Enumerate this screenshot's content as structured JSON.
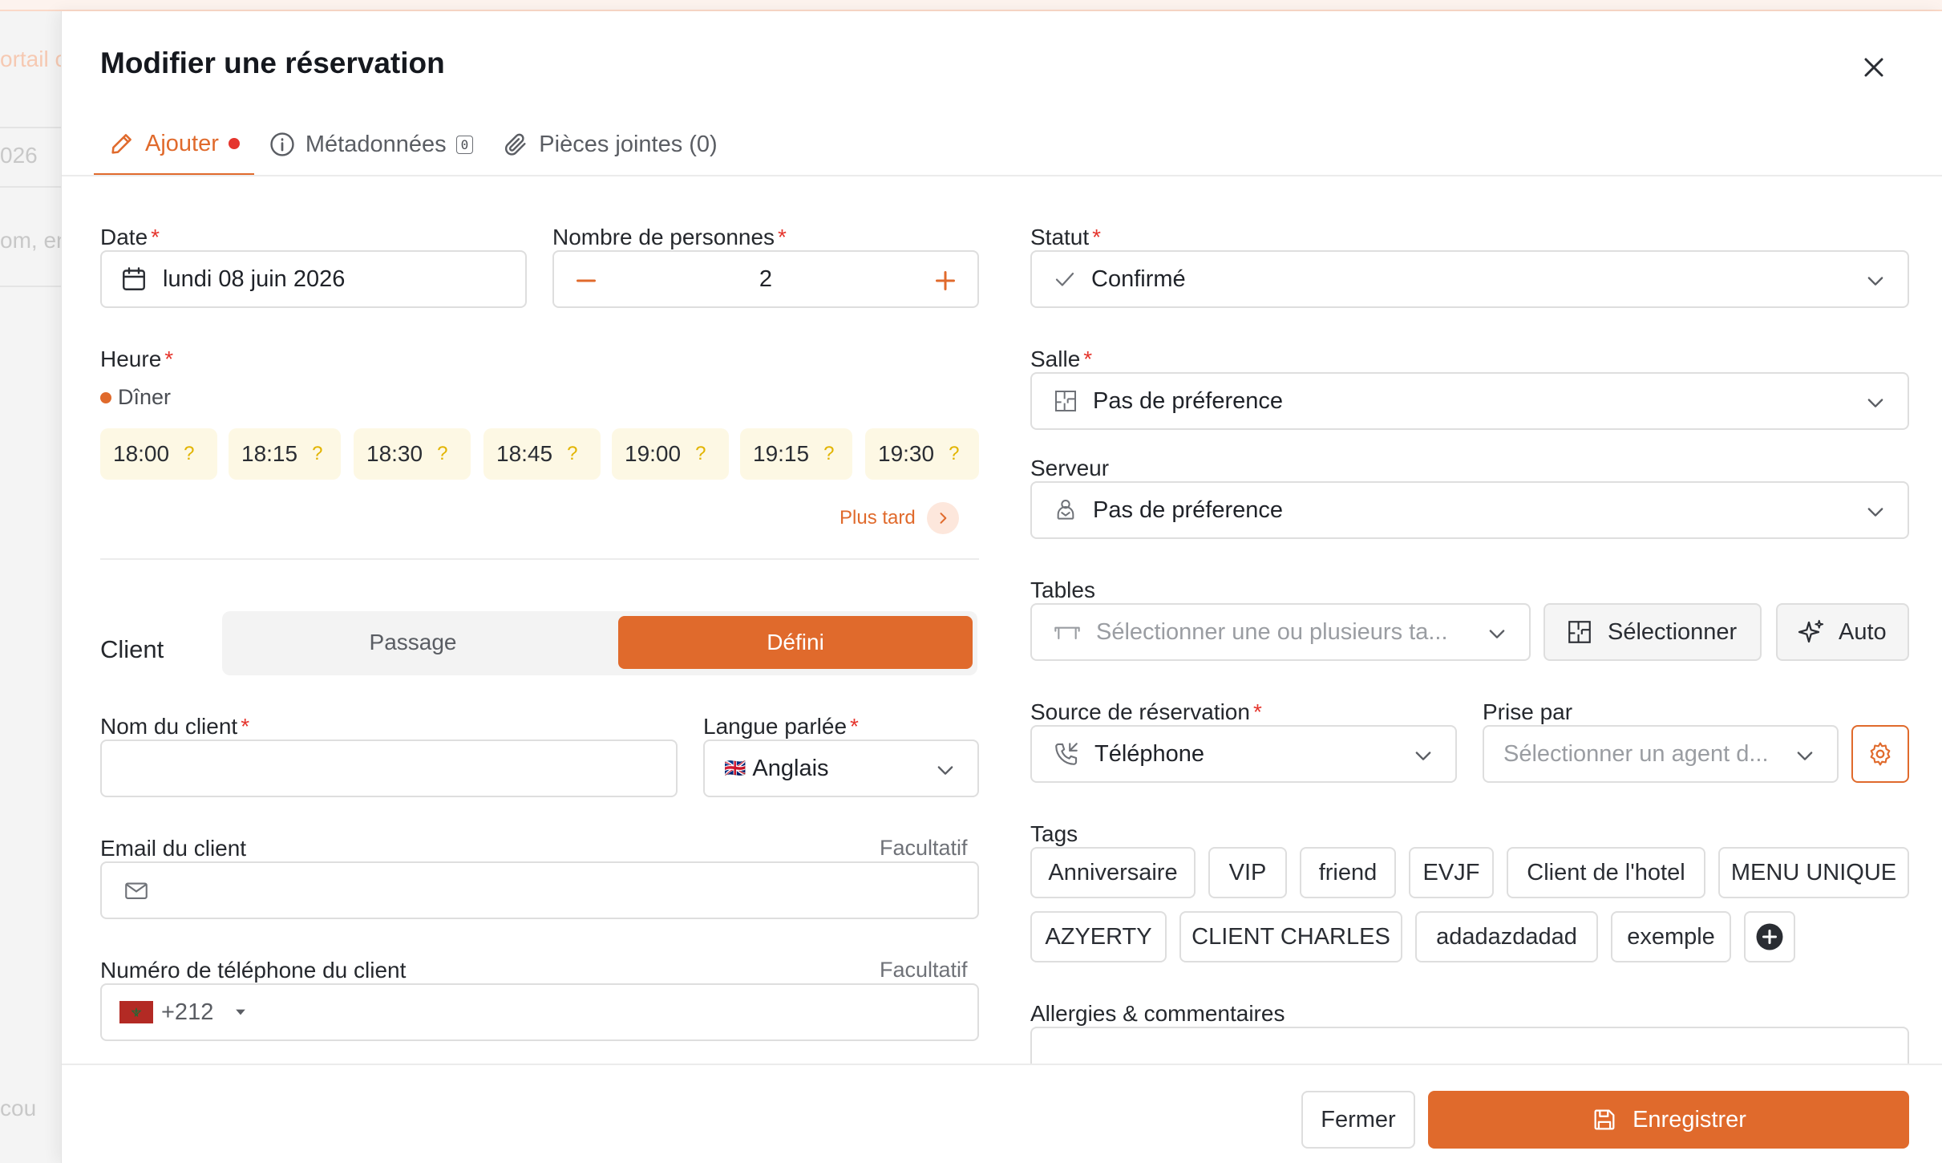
{
  "background": {
    "ghost_texts": [
      "ortail c",
      "026",
      "om, en",
      "cou"
    ]
  },
  "modal": {
    "title": "Modifier une réservation",
    "tabs": [
      {
        "label": "Ajouter",
        "icon": "pencil-icon",
        "active": true,
        "has_dot": true
      },
      {
        "label": "Métadonnées",
        "icon": "info-icon",
        "count": "0"
      },
      {
        "label": "Pièces jointes (0)",
        "icon": "paperclip-icon"
      }
    ]
  },
  "form": {
    "date": {
      "label": "Date",
      "value": "lundi 08 juin 2026"
    },
    "persons": {
      "label": "Nombre de personnes",
      "value": "2"
    },
    "time": {
      "label": "Heure",
      "service": "Dîner",
      "slots": [
        "18:00",
        "18:15",
        "18:30",
        "18:45",
        "19:00",
        "19:15",
        "19:30"
      ],
      "slot_marker": "?",
      "later_label": "Plus tard"
    },
    "client": {
      "label": "Client",
      "options": [
        "Passage",
        "Défini"
      ],
      "selected": "Défini"
    },
    "client_name": {
      "label": "Nom du client",
      "value": ""
    },
    "language": {
      "label": "Langue parlée",
      "value": "Anglais",
      "flag": "🇬🇧"
    },
    "email": {
      "label": "Email du client",
      "optional": "Facultatif",
      "value": ""
    },
    "phone": {
      "label": "Numéro de téléphone du client",
      "optional": "Facultatif",
      "prefix": "+212",
      "value": ""
    },
    "status": {
      "label": "Statut",
      "value": "Confirmé"
    },
    "room": {
      "label": "Salle",
      "value": "Pas de préference"
    },
    "server": {
      "label": "Serveur",
      "value": "Pas de préference"
    },
    "tables": {
      "label": "Tables",
      "placeholder": "Sélectionner une ou plusieurs ta...",
      "select_label": "Sélectionner",
      "auto_label": "Auto"
    },
    "source": {
      "label": "Source de réservation",
      "value": "Téléphone"
    },
    "taken_by": {
      "label": "Prise par",
      "placeholder": "Sélectionner un agent d..."
    },
    "tags": {
      "label": "Tags",
      "items": [
        "Anniversaire",
        "VIP",
        "friend",
        "EVJF",
        "Client de l'hotel",
        "MENU UNIQUE",
        "AZYERTY",
        "CLIENT CHARLES",
        "adadazdadad",
        "exemple"
      ]
    },
    "allergies": {
      "label": "Allergies & commentaires",
      "value": ""
    }
  },
  "footer": {
    "close_label": "Fermer",
    "save_label": "Enregistrer"
  },
  "colors": {
    "accent": "#e06a2c",
    "required": "#e5352d",
    "slot_bg": "#fdf8e4",
    "slot_marker": "#e2b400"
  }
}
